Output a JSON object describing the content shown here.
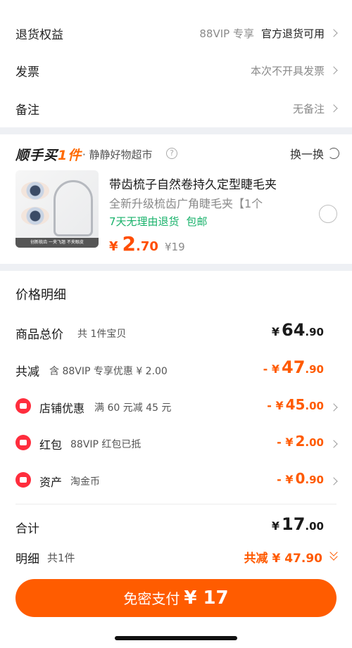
{
  "info_rows": [
    {
      "label": "退货权益",
      "value": "88VIP 专享",
      "strong": "官方退货可用"
    },
    {
      "label": "发票",
      "value": "本次不开具发票"
    },
    {
      "label": "备注",
      "value": "无备注"
    }
  ],
  "addon": {
    "brand_main": "顺手买",
    "brand_accent": "1件",
    "subtitle": "· 静静好物超市",
    "help": "?",
    "swap_label": "换一换",
    "image_caption": "创新梳齿 一夹飞翘 不夹眼皮",
    "product_title": "带齿梳子自然卷持久定型睫毛夹",
    "product_desc": "全新升级梳齿广角睫毛夹【1个",
    "tags": [
      "7天无理由退货",
      "包邮"
    ],
    "price_yen": "¥",
    "price_int": "2",
    "price_dec": ".70",
    "old_price": "¥19"
  },
  "price_detail": {
    "title": "价格明细",
    "total": {
      "label": "商品总价",
      "note": "共 1件宝贝",
      "yen": "¥",
      "int": "64",
      "dec": ".90"
    },
    "reduce": {
      "label": "共减",
      "note": "含 88VIP 专享优惠 ¥ 2.00",
      "yen": "- ¥",
      "int": "47",
      "dec": ".90"
    },
    "items": [
      {
        "label": "店铺优惠",
        "note": "满 60 元减 45 元",
        "yen": "- ¥",
        "int": "45",
        "dec": ".00",
        "icon": "store-coupon-icon"
      },
      {
        "label": "红包",
        "note": "88VIP 红包已抵",
        "yen": "- ¥",
        "int": "2",
        "dec": ".00",
        "icon": "red-packet-icon"
      },
      {
        "label": "资产",
        "note": "淘金币",
        "yen": "- ¥",
        "int": "0",
        "dec": ".90",
        "icon": "coin-tag-icon"
      }
    ],
    "sum": {
      "label": "合计",
      "yen": "¥",
      "int": "17",
      "dec": ".00"
    },
    "detail": {
      "label": "明细",
      "note": "共1件",
      "value": "共减 ¥ 47.90"
    }
  },
  "pay_button": {
    "label": "免密支付",
    "amount": "¥ 17"
  },
  "colors": {
    "accent": "#ff5c00",
    "green": "#19b26b",
    "red_icon": "#ff2d3d"
  }
}
